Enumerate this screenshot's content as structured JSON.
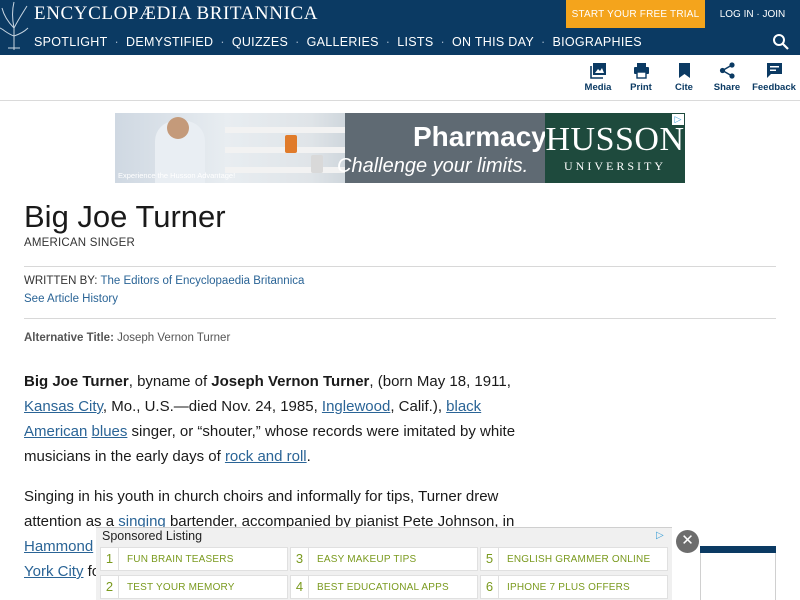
{
  "header": {
    "brand": "ENCYCLOPÆDIA BRITANNICA",
    "trial_button": "START YOUR FREE TRIAL",
    "login": "LOG IN · JOIN",
    "nav": [
      "SPOTLIGHT",
      "DEMYSTIFIED",
      "QUIZZES",
      "GALLERIES",
      "LISTS",
      "ON THIS DAY",
      "BIOGRAPHIES"
    ],
    "nav_separator": "·"
  },
  "toolbar": {
    "media": "Media",
    "print": "Print",
    "cite": "Cite",
    "share": "Share",
    "feedback": "Feedback"
  },
  "ad": {
    "headline": "Pharmacy",
    "tagline": "Challenge your limits.",
    "school": "HUSSON",
    "school_sub": "UNIVERSITY",
    "caption": "Experience the Husson Advantage!"
  },
  "article": {
    "title": "Big Joe Turner",
    "subtitle": "AMERICAN SINGER",
    "written_by_label": "WRITTEN BY:",
    "author": "The Editors of Encyclopaedia Britannica",
    "history_link": "See Article History",
    "alt_label": "Alternative Title:",
    "alt_value": "Joseph Vernon Turner",
    "p1": {
      "name_bold": "Big Joe Turner",
      "t1": ", byname of ",
      "fullname_bold": "Joseph Vernon Turner",
      "t2": ", (born May 18, 1911, ",
      "link_kc": "Kansas City",
      "t3": ", Mo., U.S.—died Nov. 24, 1985, ",
      "link_ing": "Inglewood",
      "t4": ", Calif.), ",
      "link_black": "black American",
      "t5": " ",
      "link_blues": "blues",
      "t6": " singer, or “shouter,” whose records were imitated by white musicians in the early days of ",
      "link_rnr": "rock and roll",
      "t7": "."
    },
    "p2": {
      "t1": "Singing in his youth in church choirs and informally for tips, Turner drew attention as a ",
      "link_singing": "singing",
      "t2": " bartender, accompanied by pianist Pete Johnson, in",
      "link_hammond": "Hammond",
      "link_york": "York City",
      "t3": " fo"
    }
  },
  "sponsored": {
    "title": "Sponsored Listing",
    "items": [
      {
        "num": "1",
        "label": "FUN BRAIN TEASERS"
      },
      {
        "num": "3",
        "label": "EASY MAKEUP TIPS"
      },
      {
        "num": "5",
        "label": "ENGLISH GRAMMER ONLINE"
      },
      {
        "num": "2",
        "label": "TEST YOUR MEMORY"
      },
      {
        "num": "4",
        "label": "BEST EDUCATIONAL APPS"
      },
      {
        "num": "6",
        "label": "IPHONE 7 PLUS OFFERS"
      }
    ],
    "close": "✕"
  },
  "colors": {
    "header_bg": "#0b3a63",
    "trial_bg": "#f4a41c",
    "link": "#2a6496",
    "sponsor_text": "#7a9a1e"
  },
  "icons": [
    "britannica-thistle-icon",
    "search-icon",
    "media-icon",
    "print-icon",
    "bookmark-icon",
    "share-icon",
    "feedback-icon",
    "close-icon",
    "adchoices-icon"
  ]
}
